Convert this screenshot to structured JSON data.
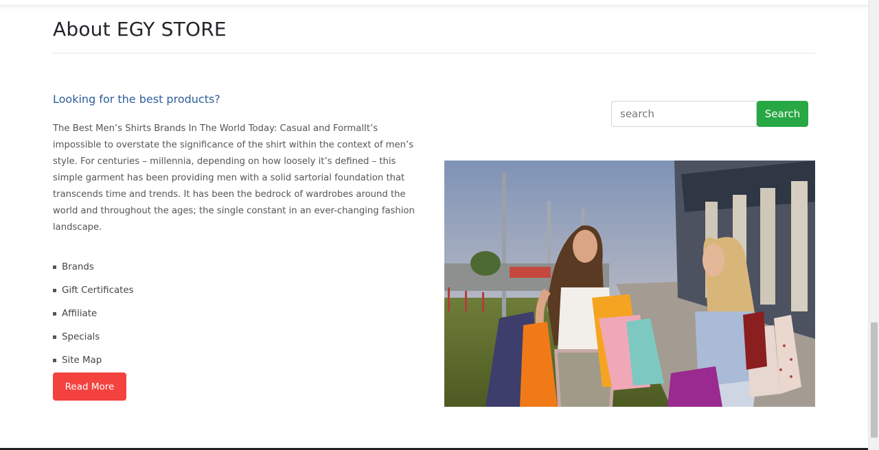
{
  "about": {
    "title": "About EGY STORE"
  },
  "content": {
    "subhead": "Looking for the best products?",
    "paragraph": "The Best Men’s Shirts Brands In The World Today: Casual and FormalIt’s impossible to overstate the significance of the shirt within the context of men’s style. For centuries – millennia, depending on how loosely it’s defined – this simple garment has been providing men with a solid sartorial foundation that transcends time and trends. It has been the bedrock of wardrobes around the world and throughout the ages; the single constant in an ever-changing fashion landscape.",
    "links": [
      "Brands",
      "Gift Certificates",
      "Affiliate",
      "Specials",
      "Site Map"
    ],
    "read_more": "Read More"
  },
  "search": {
    "placeholder": "search",
    "button": "Search"
  },
  "colors": {
    "subhead": "#2d5d9a",
    "read_more_bg": "#f4423f",
    "search_button_bg": "#28a745"
  },
  "image": {
    "icon": "shopping-women-photo"
  }
}
